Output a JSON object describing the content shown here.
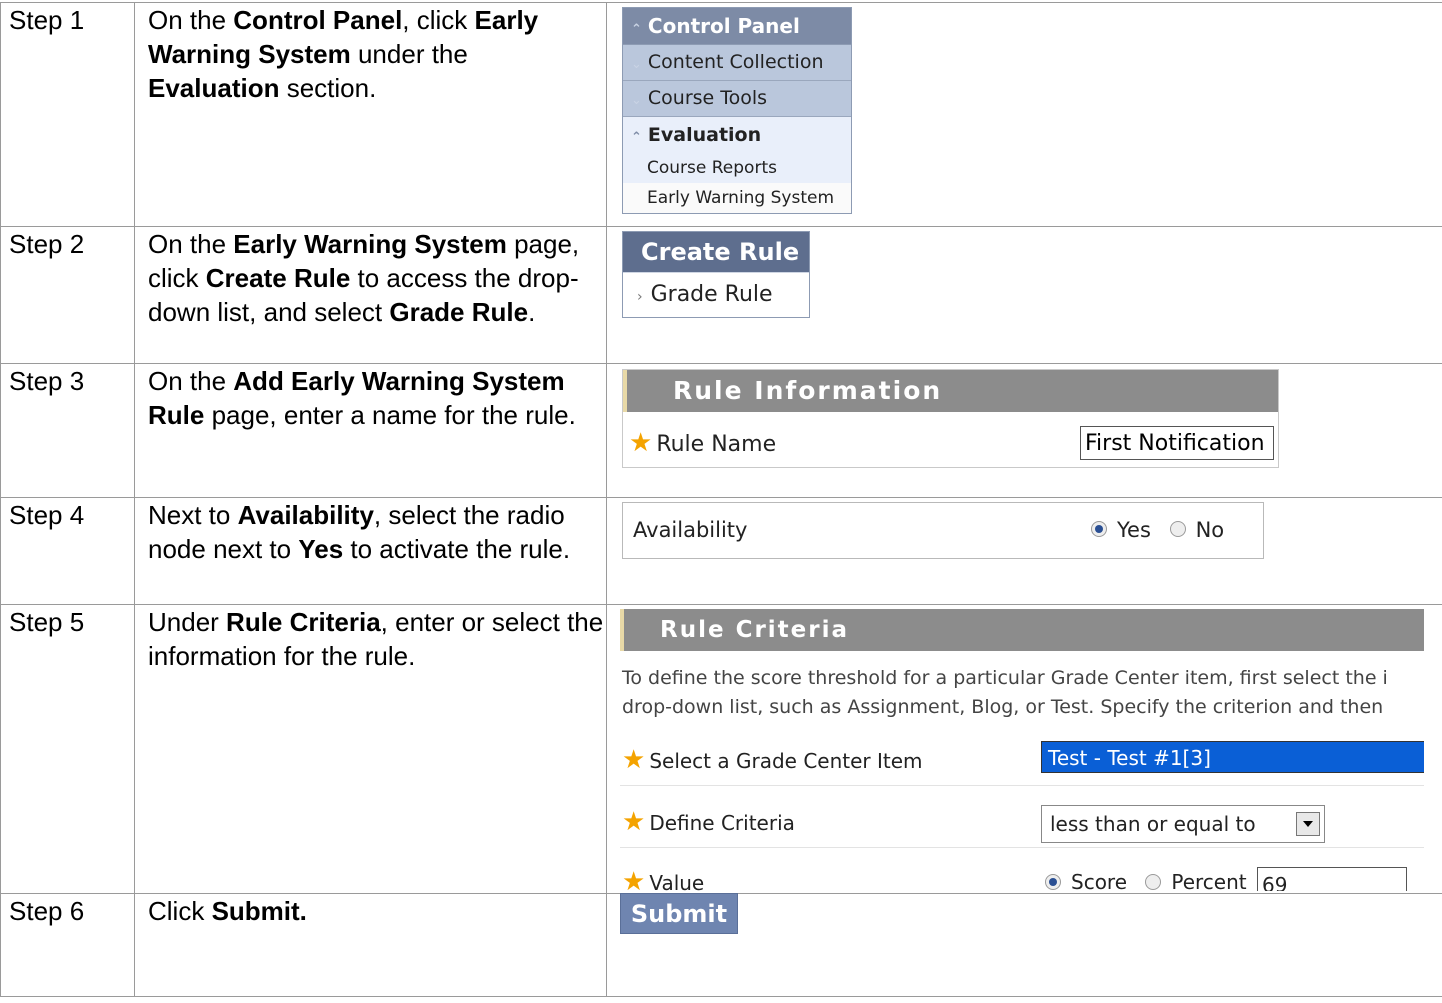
{
  "steps": [
    {
      "label": "Step 1",
      "text": [
        "On the ",
        {
          "b": "Control Panel"
        },
        ", click ",
        {
          "b": "Early Warning System"
        },
        " under the ",
        {
          "b": "Evaluation"
        },
        " section."
      ]
    },
    {
      "label": "Step 2",
      "text": [
        "On the ",
        {
          "b": "Early Warning System"
        },
        " page, click ",
        {
          "b": "Create Rule"
        },
        " to access the drop-down list, and select ",
        {
          "b": "Grade Rule"
        },
        "."
      ]
    },
    {
      "label": "Step 3",
      "text": [
        "On the ",
        {
          "b": "Add Early Warning System Rule"
        },
        " page, enter a name for the rule."
      ]
    },
    {
      "label": "Step 4",
      "text": [
        "Next to ",
        {
          "b": "Availability"
        },
        ", select the radio node next to ",
        {
          "b": "Yes"
        },
        " to activate the rule."
      ]
    },
    {
      "label": "Step 5",
      "text": [
        "Under ",
        {
          "b": "Rule Criteria"
        },
        ", enter or select the information for the rule."
      ]
    },
    {
      "label": "Step 6",
      "text": [
        "Click ",
        {
          "b": "Submit."
        }
      ]
    }
  ],
  "control_panel": {
    "title": "Control Panel",
    "items": [
      "Content Collection",
      "Course Tools"
    ],
    "section": "Evaluation",
    "sub_items": [
      "Course Reports",
      "Early Warning System"
    ]
  },
  "create_rule": {
    "title": "Create Rule",
    "item": "Grade Rule"
  },
  "rule_information": {
    "title": "Rule Information",
    "name_label": "Rule Name",
    "name_value": "First Notification"
  },
  "availability": {
    "label": "Availability",
    "yes": "Yes",
    "no": "No",
    "selected": "Yes"
  },
  "rule_criteria": {
    "title": "Rule Criteria",
    "description_line1": "To define the score threshold for a particular Grade Center item, first select the i",
    "description_line2": "drop-down list, such as Assignment, Blog, or Test. Specify the criterion and then",
    "item_label": "Select a Grade Center Item",
    "item_value": "Test - Test #1[3]",
    "criteria_label": "Define Criteria",
    "criteria_value": "less than or equal to",
    "value_label": "Value",
    "score_label": "Score",
    "percent_label": "Percent",
    "value": "69"
  },
  "submit": {
    "label": "Submit"
  }
}
